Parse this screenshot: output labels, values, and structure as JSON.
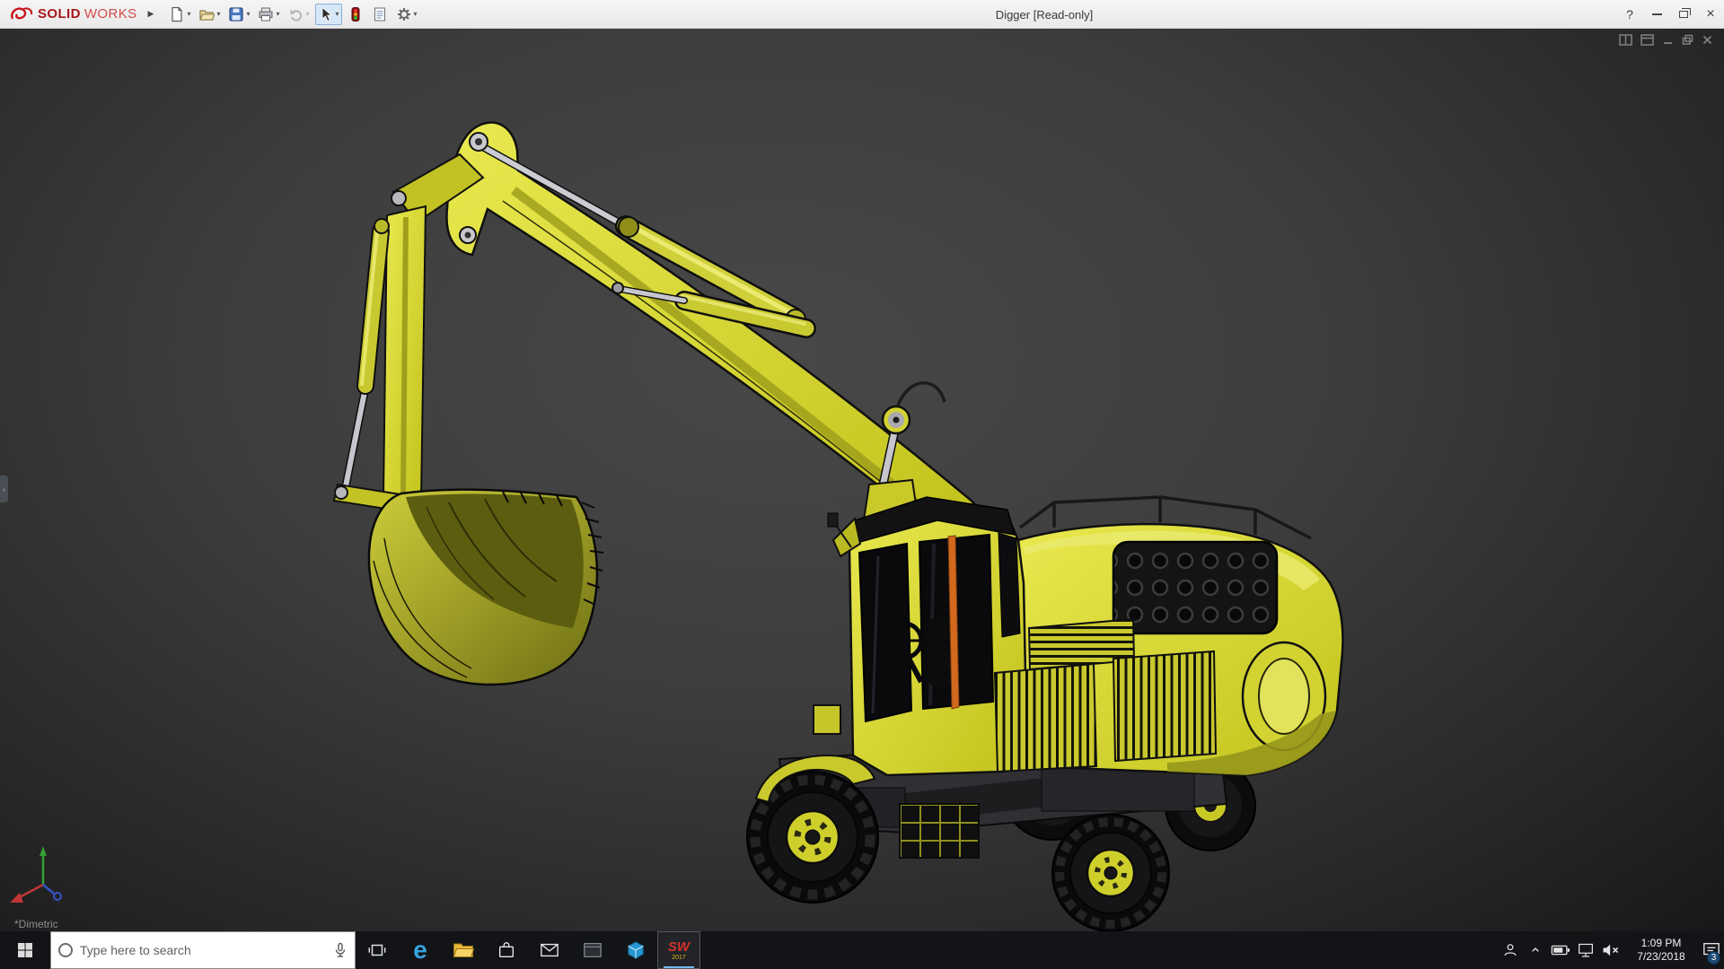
{
  "colors": {
    "titlebar_bg": "#efefef",
    "brand_red": "#c8141a",
    "viewport_top": "#484848",
    "viewport_bottom": "#181818",
    "taskbar_bg": "#121418",
    "model_yellow": "#d7d731",
    "active_tool_bg": "#d8e7f7"
  },
  "titlebar": {
    "brand_bold": "SOLID",
    "brand_light": "WORKS",
    "flyout_arrow": "▶",
    "dropdown_glyph": "▾",
    "tools": [
      "new-document-icon",
      "open-icon",
      "save-icon",
      "print-icon",
      "undo-icon",
      "select-icon",
      "rebuild-icon",
      "file-properties-icon",
      "options-icon"
    ],
    "title": "Digger [Read-only]",
    "help_glyph": "?",
    "close_glyph": "×"
  },
  "viewport": {
    "orientation_label": "*Dimetric",
    "doc_controls": [
      "pane-split-icon",
      "pane-full-icon",
      "minimize-icon",
      "restore-icon",
      "close-icon"
    ],
    "collapsed_tab_glyph": "‹"
  },
  "taskbar": {
    "search_placeholder": "Type here to search",
    "edge_glyph": "e",
    "sw_label": "SW",
    "sw_year": "2017",
    "app_icons": [
      "start-icon",
      "cortana-icon",
      "microphone-icon",
      "task-view-icon",
      "edge-icon",
      "file-explorer-icon",
      "store-icon",
      "mail-icon",
      "console-app-icon",
      "cube-app-icon",
      "solidworks-icon"
    ],
    "tray_icons": [
      "people-icon",
      "hidden-icons-chevron",
      "battery-icon",
      "network-icon",
      "volume-muted-icon",
      "action-center-icon"
    ],
    "clock": {
      "time": "1:09 PM",
      "date": "7/23/2018"
    },
    "badge": "3"
  }
}
